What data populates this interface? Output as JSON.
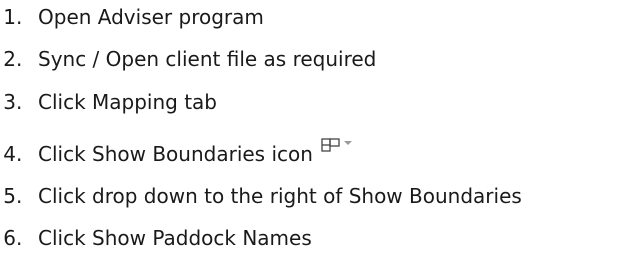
{
  "steps": [
    {
      "number": "1",
      "text": "Open Adviser program"
    },
    {
      "number": "2",
      "text": "Sync / Open client file as required"
    },
    {
      "number": "3",
      "text": "Click Mapping tab"
    },
    {
      "number": "4",
      "text": "Click Show Boundaries icon",
      "icon": "show-boundaries-icon"
    },
    {
      "number": "5",
      "text": "Click drop down to the right of Show Boundaries"
    },
    {
      "number": "6",
      "text": "Click Show Paddock Names"
    }
  ],
  "colors": {
    "text": "#1a1a1a",
    "icon": "#444444",
    "caret": "#9a9a9a"
  }
}
